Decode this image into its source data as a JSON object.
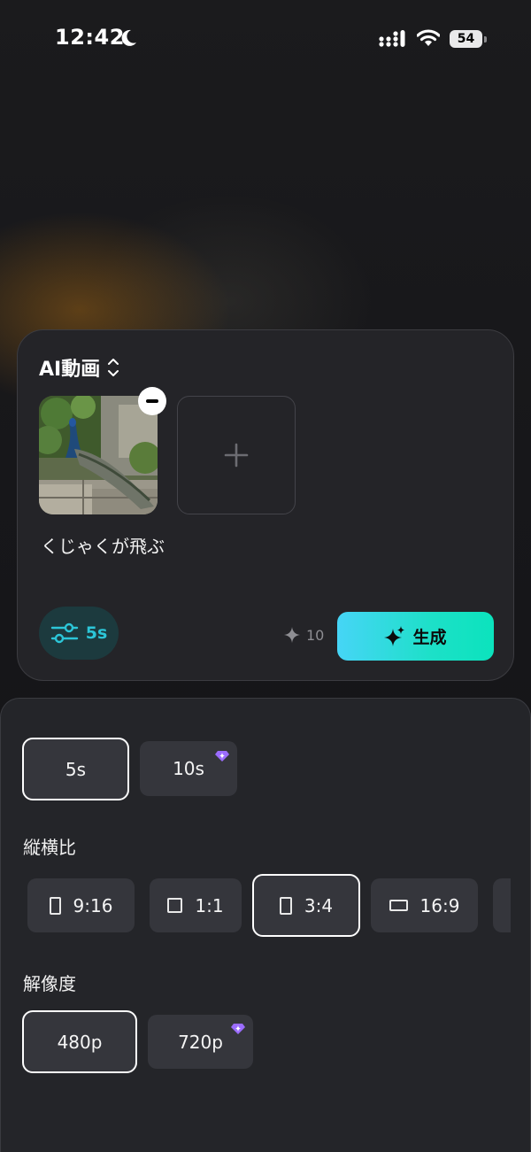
{
  "status_bar": {
    "time": "12:42",
    "battery": "54"
  },
  "card": {
    "mode_label": "AI動画",
    "prompt": "くじゃくが飛ぶ",
    "settings_label": "5s",
    "credits": "10",
    "generate_label": "生成",
    "accent_color": "#2cc6d8"
  },
  "sheet": {
    "durations": [
      {
        "label": "5s",
        "selected": true,
        "premium": false
      },
      {
        "label": "10s",
        "selected": false,
        "premium": true
      }
    ],
    "aspect_title": "縦横比",
    "aspects": [
      {
        "label": "9:16",
        "selected": false
      },
      {
        "label": "1:1",
        "selected": false
      },
      {
        "label": "3:4",
        "selected": true
      },
      {
        "label": "16:9",
        "selected": false
      }
    ],
    "resolution_title": "解像度",
    "resolutions": [
      {
        "label": "480p",
        "selected": true,
        "premium": false
      },
      {
        "label": "720p",
        "selected": false,
        "premium": true
      }
    ],
    "premium_color": "#9b6cff"
  }
}
